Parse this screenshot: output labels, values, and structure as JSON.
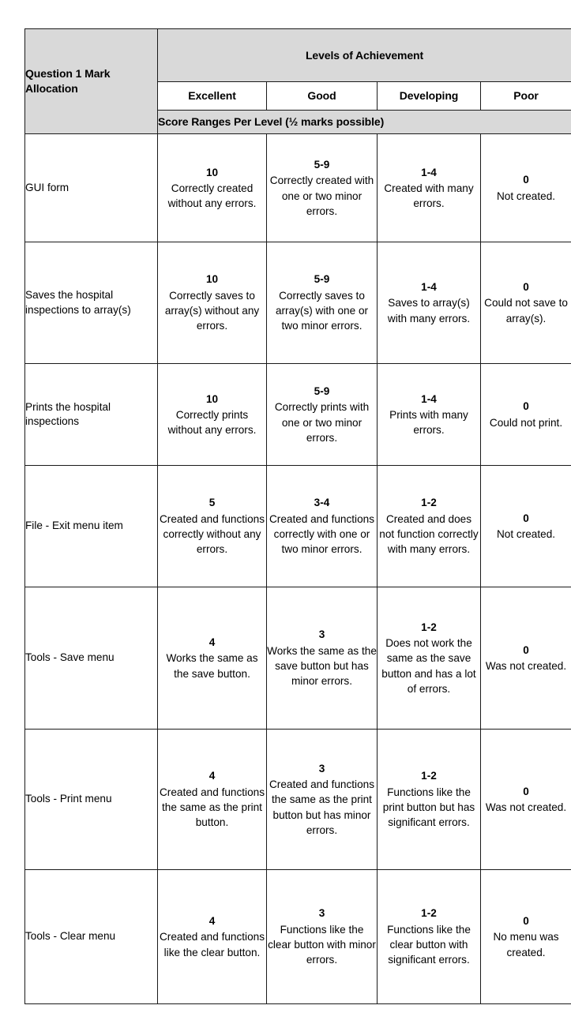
{
  "table": {
    "header": {
      "criterion_title": "Question 1 Mark Allocation",
      "levels_title": "Levels of Achievement",
      "levels": [
        "Excellent",
        "Good",
        "Developing",
        "Poor"
      ],
      "score_ranges_note": "Score Ranges Per Level (½ marks possible)"
    },
    "rows": [
      {
        "criterion": "GUI form",
        "cells": [
          {
            "score": "10",
            "desc": "Correctly created without any errors."
          },
          {
            "score": "5-9",
            "desc": "Correctly created with one or two minor errors."
          },
          {
            "score": "1-4",
            "desc": "Created with many errors."
          },
          {
            "score": "0",
            "desc": "Not created."
          }
        ]
      },
      {
        "criterion": "Saves the hospital inspections to array(s)",
        "cells": [
          {
            "score": "10",
            "desc": "Correctly saves to array(s) without any errors."
          },
          {
            "score": "5-9",
            "desc": "Correctly saves to array(s) with one or two minor errors."
          },
          {
            "score": "1-4",
            "desc": "Saves to array(s) with many errors."
          },
          {
            "score": "0",
            "desc": "Could not save to array(s)."
          }
        ]
      },
      {
        "criterion": "Prints the hospital inspections",
        "cells": [
          {
            "score": "10",
            "desc": "Correctly prints without any errors."
          },
          {
            "score": "5-9",
            "desc": "Correctly prints with one or two minor errors."
          },
          {
            "score": "1-4",
            "desc": "Prints with many errors."
          },
          {
            "score": "0",
            "desc": "Could not print."
          }
        ]
      },
      {
        "criterion": "File - Exit menu item",
        "cells": [
          {
            "score": "5",
            "desc": "Created and functions correctly without any errors."
          },
          {
            "score": "3-4",
            "desc": "Created and functions correctly with one or two minor errors."
          },
          {
            "score": "1-2",
            "desc": "Created and does not function correctly with many errors."
          },
          {
            "score": "0",
            "desc": "Not created."
          }
        ]
      },
      {
        "criterion": "Tools - Save menu",
        "cells": [
          {
            "score": "4",
            "desc": "Works the same as the save button."
          },
          {
            "score": "3",
            "desc": "Works the same as the save button but has minor errors."
          },
          {
            "score": "1-2",
            "desc": "Does not work the same as the save button and has a lot of errors."
          },
          {
            "score": "0",
            "desc": "Was not created."
          }
        ]
      },
      {
        "criterion": "Tools - Print menu",
        "cells": [
          {
            "score": "4",
            "desc": "Created and functions the same as the print button."
          },
          {
            "score": "3",
            "desc": "Created and functions the same as the print button but has minor errors."
          },
          {
            "score": "1-2",
            "desc": "Functions like the print button but has significant errors."
          },
          {
            "score": "0",
            "desc": "Was not created."
          }
        ]
      },
      {
        "criterion": "Tools - Clear menu",
        "cells": [
          {
            "score": "4",
            "desc": "Created and functions like the clear button."
          },
          {
            "score": "3",
            "desc": "Functions like the clear button with minor errors."
          },
          {
            "score": "1-2",
            "desc": "Functions like the clear button with significant errors."
          },
          {
            "score": "0",
            "desc": "No menu was created."
          }
        ]
      }
    ]
  }
}
